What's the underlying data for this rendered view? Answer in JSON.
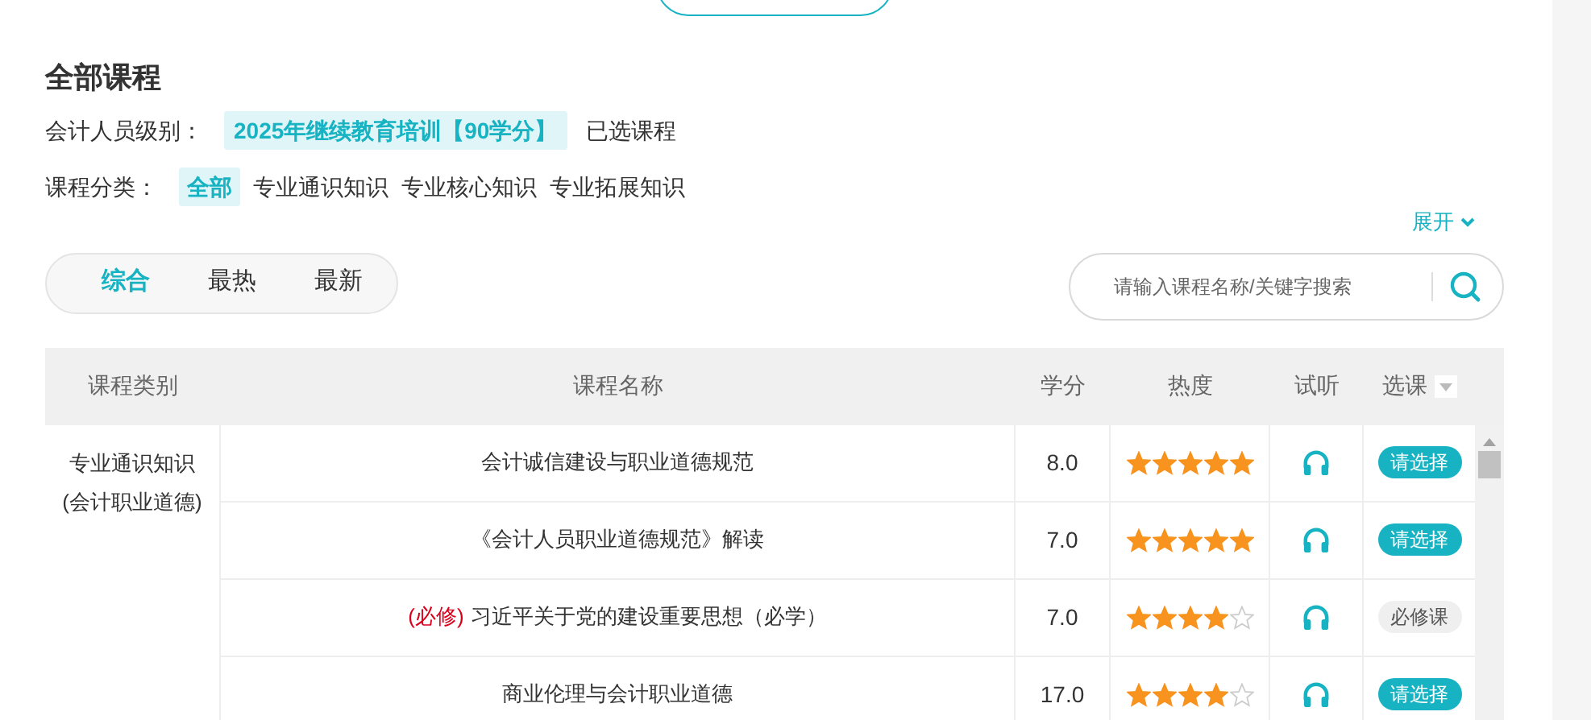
{
  "title": "全部课程",
  "level_filter": {
    "label": "会计人员级别：",
    "options": [
      {
        "label": "2025年继续教育培训【90学分】",
        "selected": true
      },
      {
        "label": "已选课程",
        "selected": false
      }
    ]
  },
  "category_filter": {
    "label": "课程分类：",
    "options": [
      {
        "label": "全部",
        "selected": true
      },
      {
        "label": "专业通识知识",
        "selected": false
      },
      {
        "label": "专业核心知识",
        "selected": false
      },
      {
        "label": "专业拓展知识",
        "selected": false
      }
    ]
  },
  "expand_link": "展开",
  "sort_tabs": [
    {
      "label": "综合",
      "selected": true
    },
    {
      "label": "最热",
      "selected": false
    },
    {
      "label": "最新",
      "selected": false
    }
  ],
  "search": {
    "placeholder": "请输入课程名称/关键字搜索"
  },
  "table": {
    "columns": [
      "课程类别",
      "课程名称",
      "学分",
      "热度",
      "试听",
      "选课"
    ],
    "category": [
      "专业通识知识",
      "(会计职业道德)"
    ],
    "rows": [
      {
        "name": "会计诚信建设与职业道德规范",
        "credit": "8.0",
        "stars": 5,
        "action": {
          "kind": "select",
          "label": "请选择"
        }
      },
      {
        "name": "《会计人员职业道德规范》解读",
        "credit": "7.0",
        "stars": 5,
        "action": {
          "kind": "select",
          "label": "请选择"
        }
      },
      {
        "prefix": "(必修)",
        "name": "习近平关于党的建设重要思想（必学）",
        "credit": "7.0",
        "stars": 4,
        "action": {
          "kind": "required",
          "label": "必修课"
        }
      },
      {
        "name": "商业伦理与会计职业道德",
        "credit": "17.0",
        "stars": 4,
        "action": {
          "kind": "select",
          "label": "请选择"
        }
      }
    ]
  }
}
